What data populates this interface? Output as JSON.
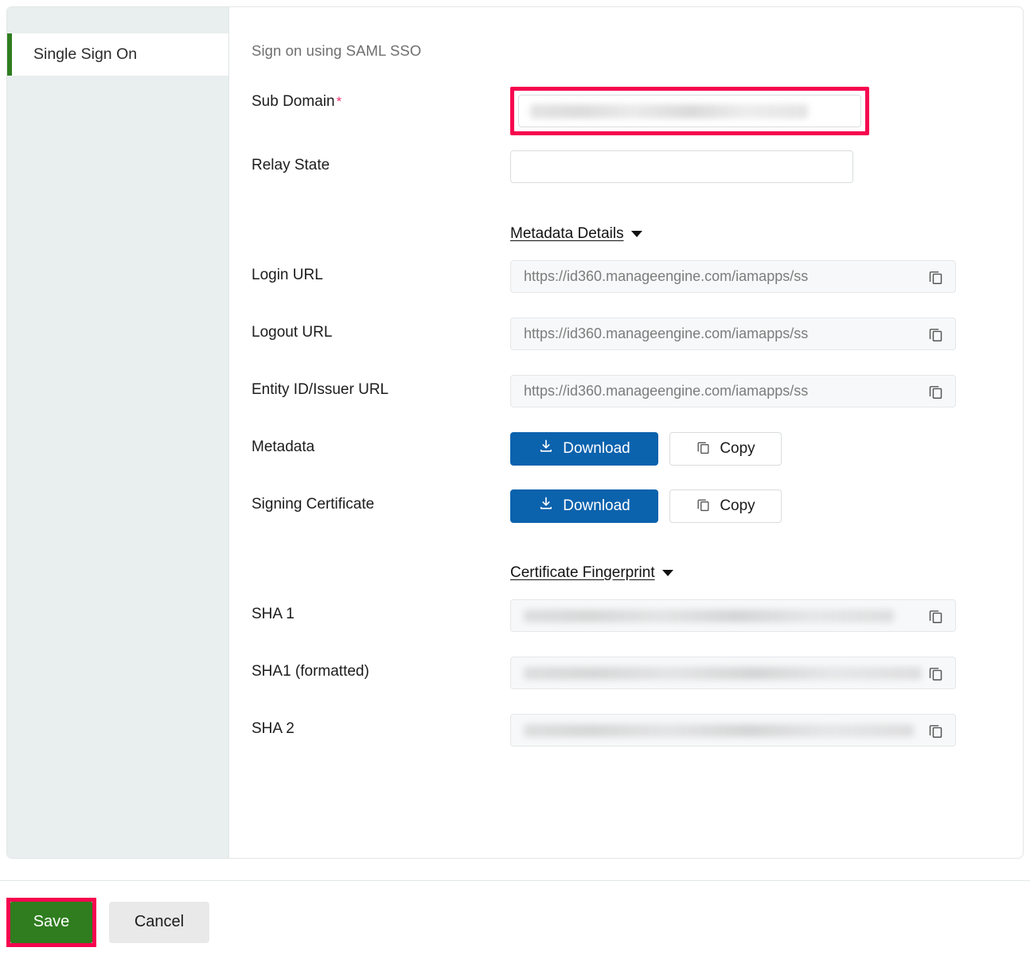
{
  "sidebar": {
    "items": [
      {
        "label": "Single Sign On",
        "active": true,
        "name": "sidebar-item-single-sign-on"
      }
    ]
  },
  "content": {
    "header": "Sign on using SAML SSO",
    "fields": {
      "sub_domain": {
        "label": "Sub Domain",
        "required_marker": "*",
        "value": "",
        "placeholder": "",
        "redacted": true,
        "highlighted": true,
        "highlight_color": "#f5054f"
      },
      "relay_state": {
        "label": "Relay State",
        "value": "",
        "placeholder": ""
      },
      "login_url": {
        "label": "Login URL",
        "value": "https://id360.manageengine.com/iamapps/ss",
        "copy_label": "copy-icon"
      },
      "logout_url": {
        "label": "Logout URL",
        "value": "https://id360.manageengine.com/iamapps/ss",
        "copy_label": "copy-icon"
      },
      "entity_id_url": {
        "label": "Entity ID/Issuer URL",
        "value": "https://id360.manageengine.com/iamapps/ss",
        "copy_label": "copy-icon"
      },
      "metadata": {
        "label": "Metadata",
        "download_label": "Download",
        "copy_label": "Copy"
      },
      "signing_certificate": {
        "label": "Signing Certificate",
        "download_label": "Download",
        "copy_label": "Copy"
      },
      "sha1": {
        "label": "SHA 1",
        "value": "",
        "redacted": true
      },
      "sha1_formatted": {
        "label": "SHA1 (formatted)",
        "value": "",
        "redacted": true
      },
      "sha2": {
        "label": "SHA 2",
        "value": "",
        "redacted": true
      }
    },
    "links": {
      "metadata_details": "Metadata Details",
      "certificate_fingerprint": "Certificate Fingerprint"
    }
  },
  "footer": {
    "save_label": "Save",
    "cancel_label": "Cancel",
    "save_color": "#2f7d1f",
    "save_highlight_color": "#f5054f"
  },
  "colors": {
    "accent_green": "#2f7d1f",
    "accent_blue": "#0b62ad",
    "highlight_pink": "#f5054f",
    "sidebar_bg": "#e9eeef",
    "required_star": "#e8336d"
  }
}
